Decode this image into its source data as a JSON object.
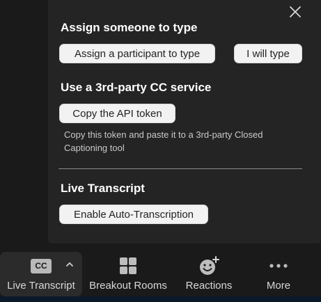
{
  "popup": {
    "section_assign": {
      "title": "Assign someone to type",
      "assign_button": "Assign a participant to type",
      "self_button": "I will type"
    },
    "section_third_party": {
      "title": "Use a 3rd-party CC service",
      "copy_button": "Copy the API token",
      "note": "Copy this token and paste it to a 3rd-party Closed Captioning tool"
    },
    "section_transcript": {
      "title": "Live Transcript",
      "enable_button": "Enable Auto-Transcription"
    }
  },
  "toolbar": {
    "items": [
      {
        "label": "Live Transcript",
        "icon": "closed-caption-icon",
        "icon_text": "CC"
      },
      {
        "label": "Breakout Rooms",
        "icon": "breakout-rooms-icon"
      },
      {
        "label": "Reactions",
        "icon": "reactions-icon"
      },
      {
        "label": "More",
        "icon": "more-icon"
      }
    ]
  },
  "colors": {
    "popup_bg": "#242424",
    "page_bg": "#1a1a1a",
    "button_bg": "#f2f2f2",
    "title_text": "#ffffff"
  }
}
